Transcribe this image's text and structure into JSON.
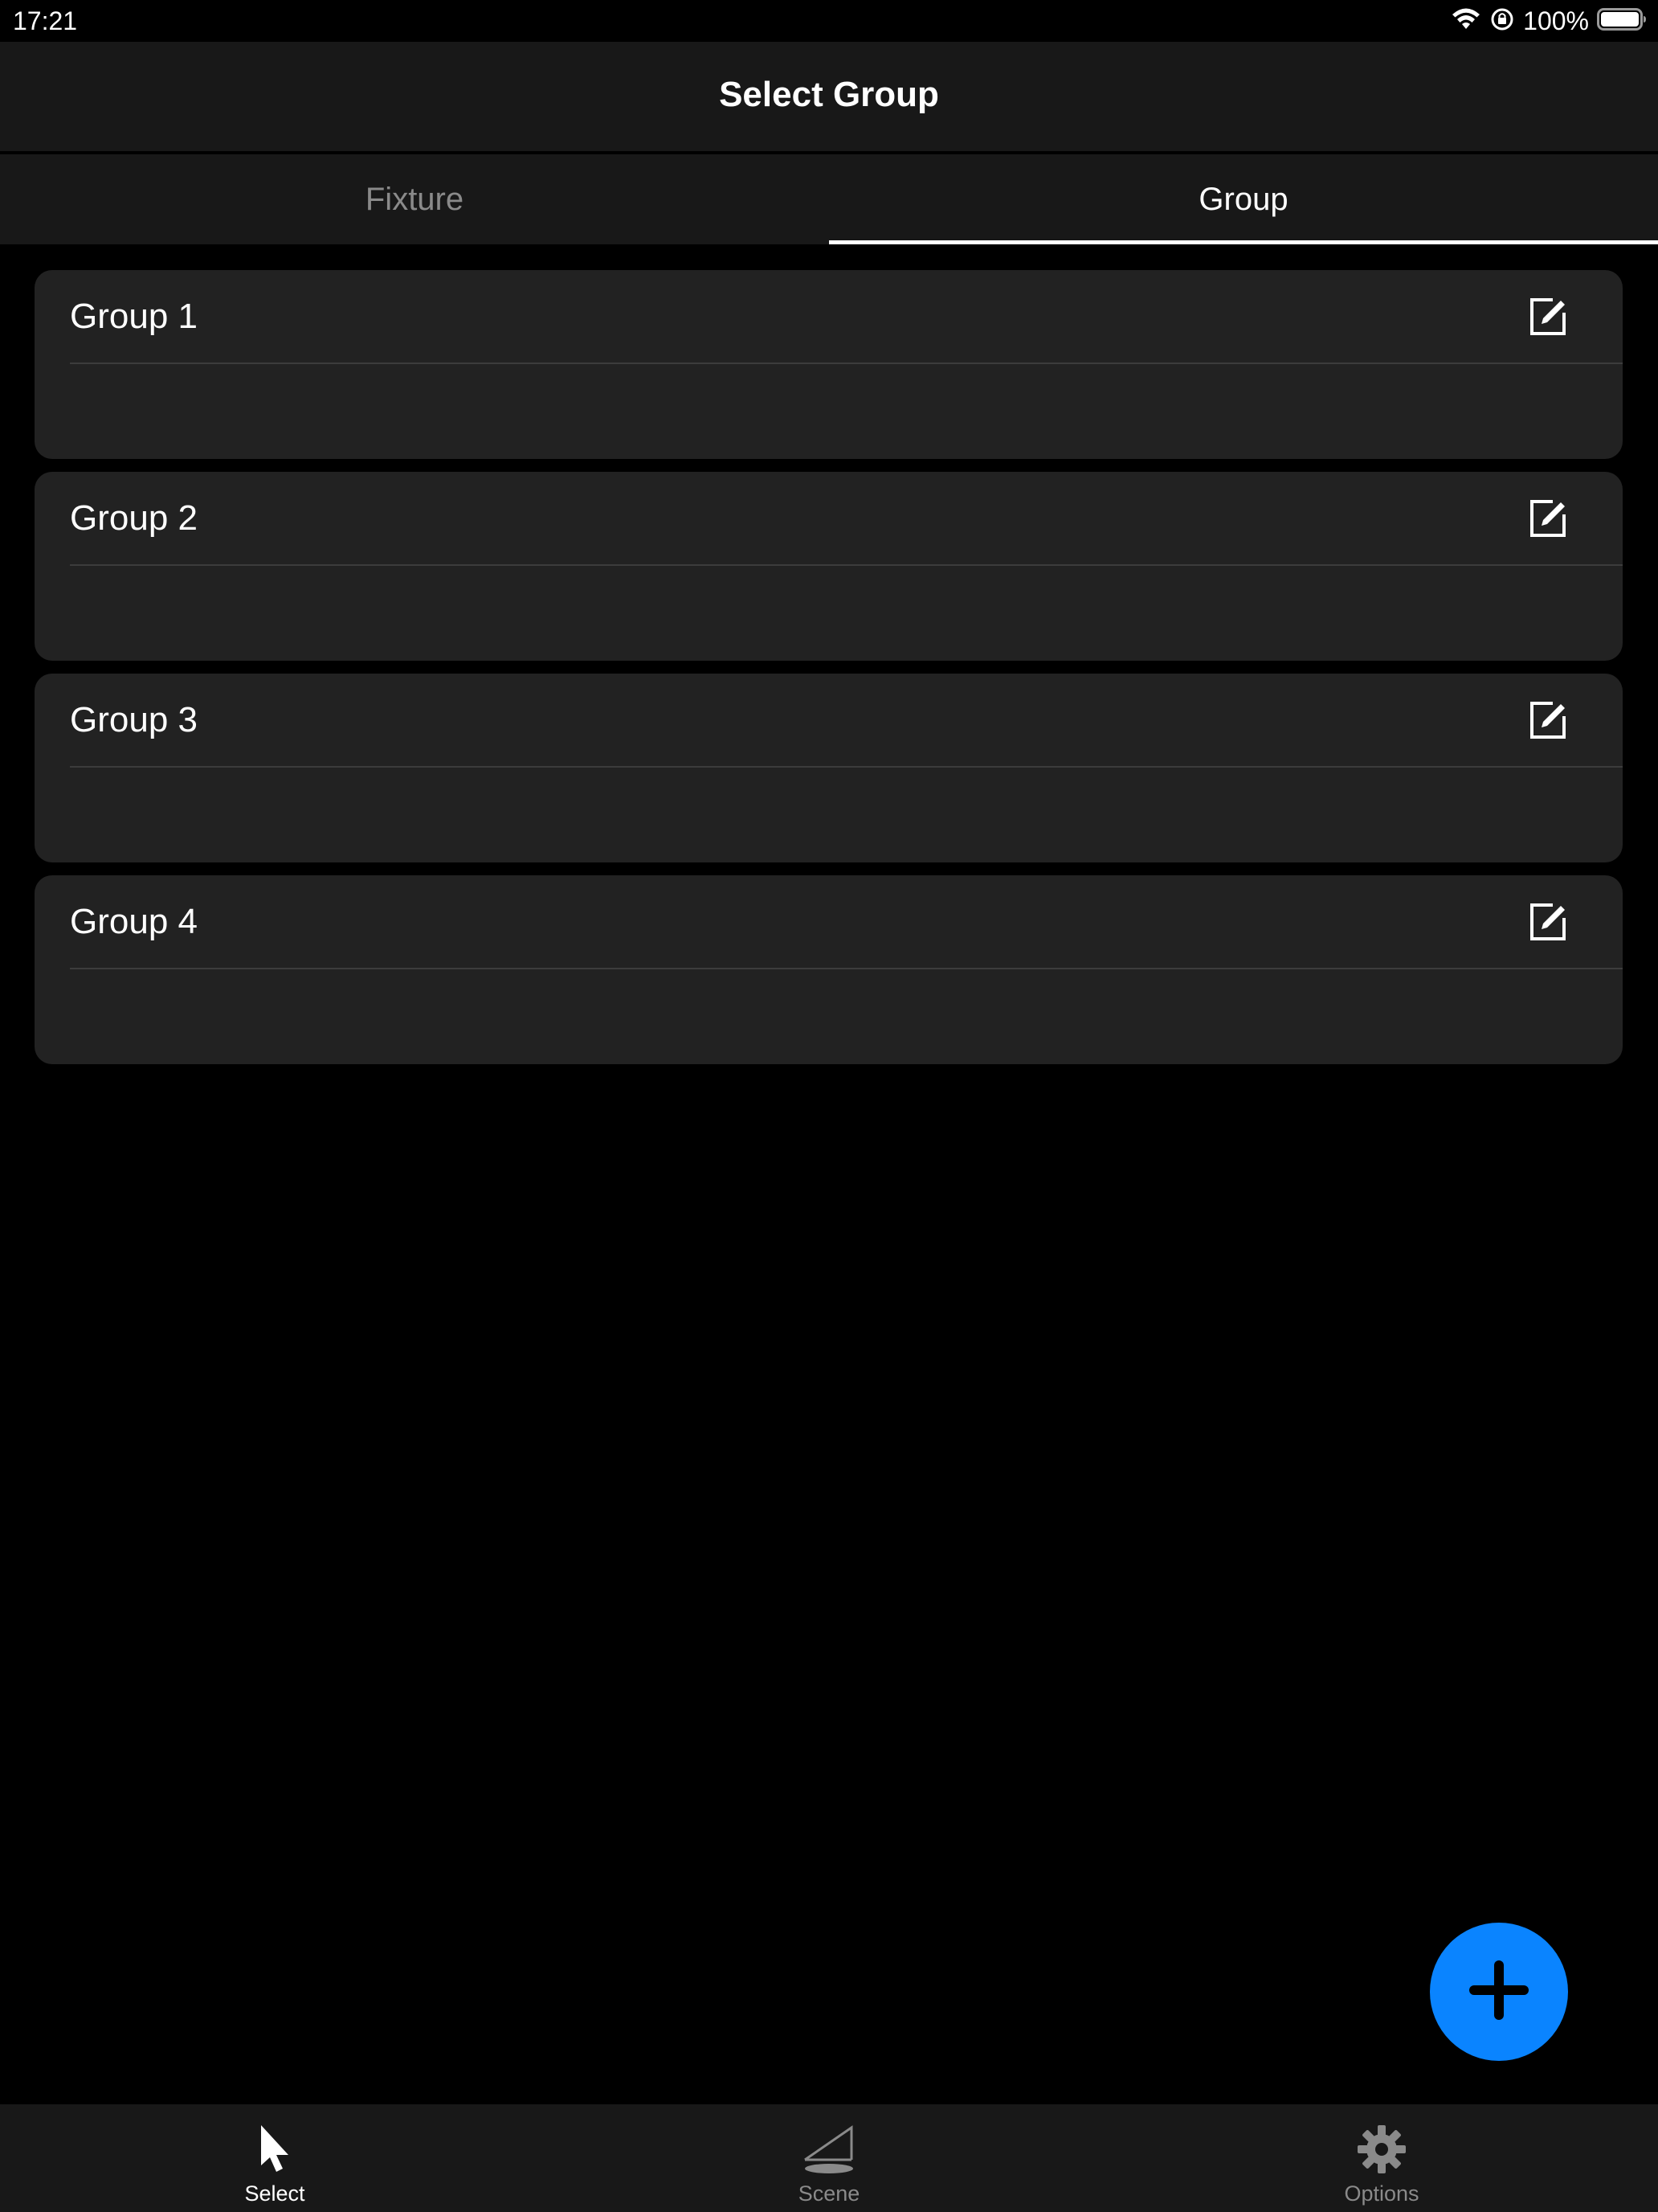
{
  "status_bar": {
    "time": "17:21",
    "battery_percent": "100%",
    "battery_level": 1.0
  },
  "nav": {
    "title": "Select Group"
  },
  "tabs": [
    {
      "label": "Fixture",
      "active": false
    },
    {
      "label": "Group",
      "active": true
    }
  ],
  "groups": [
    {
      "name": "Group 1"
    },
    {
      "name": "Group 2"
    },
    {
      "name": "Group 3"
    },
    {
      "name": "Group 4"
    }
  ],
  "tab_bar": [
    {
      "label": "Select",
      "icon": "pointer-icon",
      "active": true
    },
    {
      "label": "Scene",
      "icon": "scene-light-icon",
      "active": false
    },
    {
      "label": "Options",
      "icon": "gear-icon",
      "active": false
    }
  ],
  "colors": {
    "accent": "#0a84ff",
    "background": "#000000",
    "card": "#222222",
    "bar": "#181818",
    "inactive_text": "#8a8a8a"
  }
}
